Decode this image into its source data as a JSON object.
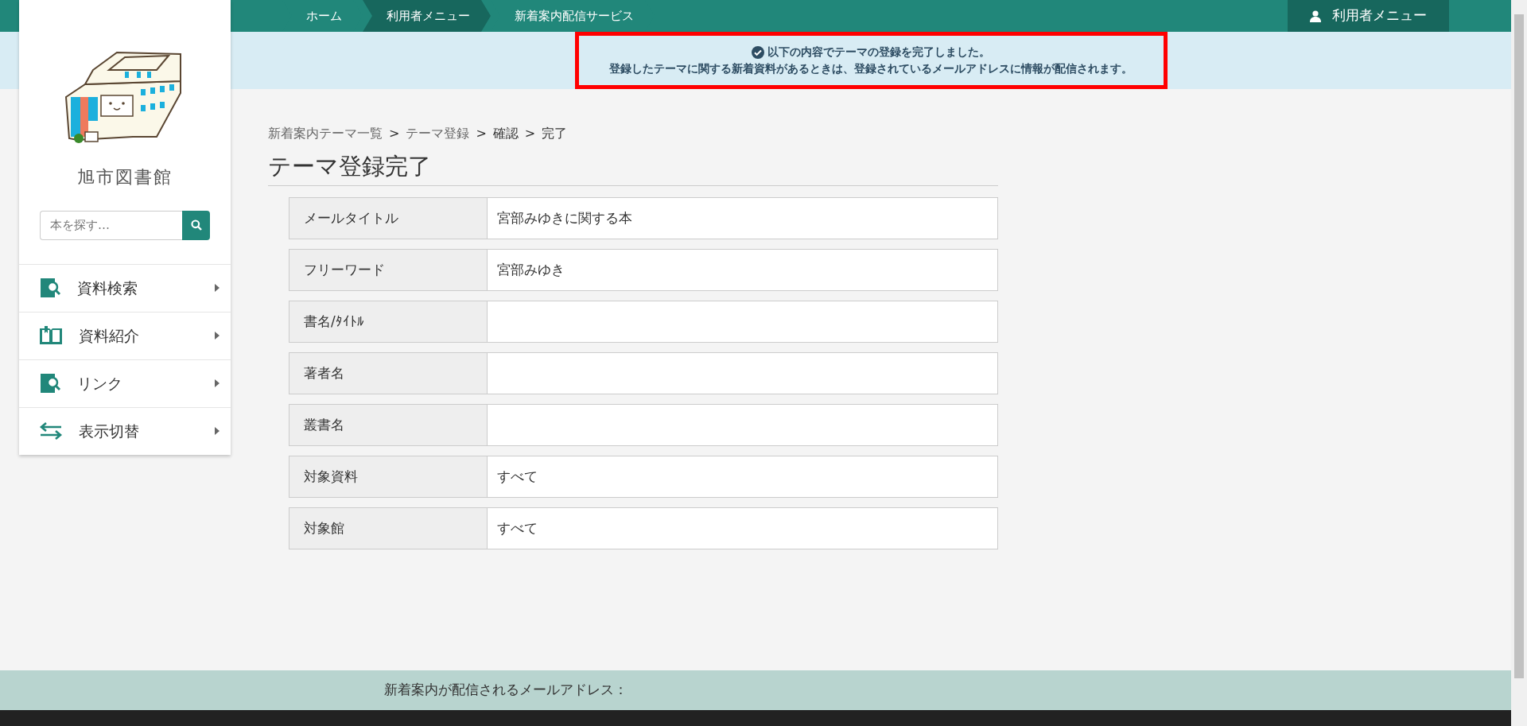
{
  "topnav": {
    "breadcrumbs": [
      {
        "label": "ホーム",
        "selected": false
      },
      {
        "label": "利用者メニュー",
        "selected": true
      },
      {
        "label": "新着案内配信サービス",
        "selected": false
      }
    ],
    "user_menu": "利用者メニュー"
  },
  "notice": {
    "lines": [
      "以下の内容でテーマの登録を完了しました。",
      "登録したテーマに関する新着資料があるときは、登録されているメールアドレスに情報が配信されます。"
    ]
  },
  "sidebar": {
    "library_name": "旭市図書館",
    "search": {
      "placeholder": "本を探す…"
    },
    "items": [
      {
        "label": "資料検索",
        "kind": "search"
      },
      {
        "label": "資料紹介",
        "kind": "book"
      },
      {
        "label": "リンク",
        "kind": "search"
      },
      {
        "label": "表示切替",
        "kind": "swap"
      }
    ]
  },
  "breadcrumb": [
    {
      "label": "新着案内テーマ一覧",
      "kind": "link"
    },
    {
      "label": ">",
      "kind": "separator"
    },
    {
      "label": "テーマ登録",
      "kind": "link"
    },
    {
      "label": ">",
      "kind": "separator"
    },
    {
      "label": "確認",
      "kind": "current"
    },
    {
      "label": ">",
      "kind": "separator"
    },
    {
      "label": "完了",
      "kind": "current"
    }
  ],
  "heading": "テーマ登録完了",
  "table": {
    "rows": [
      {
        "label": "メールタイトル",
        "value": "宮部みゆきに関する本"
      },
      {
        "label": "フリーワード",
        "value": "宮部みゆき"
      },
      {
        "label": "書名/ﾀｲﾄﾙ"
      },
      {
        "label": "著者名"
      },
      {
        "label": "叢書名"
      },
      {
        "label": "対象資料",
        "value": "すべて"
      },
      {
        "label": "対象館",
        "value": "すべて"
      }
    ]
  },
  "footer": {
    "text": "新着案内が配信されるメールアドレス："
  }
}
